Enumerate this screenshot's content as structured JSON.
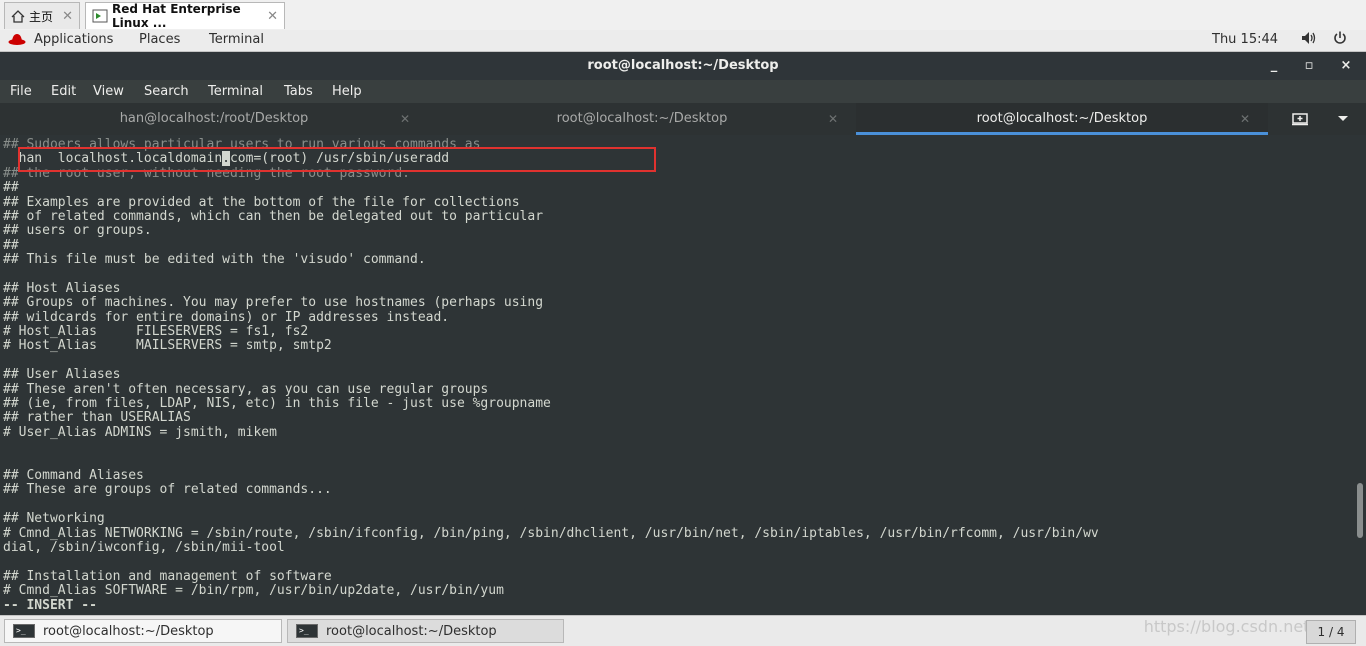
{
  "host_tabs": [
    {
      "label": "主页",
      "icon": "home-icon"
    },
    {
      "label": "Red Hat Enterprise Linux ...",
      "icon": "vm-icon"
    }
  ],
  "gnome": {
    "applications": "Applications",
    "places": "Places",
    "terminal": "Terminal",
    "clock": "Thu 15:44"
  },
  "window": {
    "title": "root@localhost:~/Desktop",
    "minimize": "_",
    "maximize": "▫",
    "close": "×"
  },
  "menu": [
    "File",
    "Edit",
    "View",
    "Search",
    "Terminal",
    "Tabs",
    "Help"
  ],
  "terminal_tabs": [
    {
      "label": "han@localhost:/root/Desktop"
    },
    {
      "label": "root@localhost:~/Desktop"
    },
    {
      "label": "root@localhost:~/Desktop"
    }
  ],
  "terminal": {
    "lines": [
      "## Sudoers allows particular users to run various commands as",
      "  han  localhost.localdomain.com=(root) /usr/sbin/useradd",
      "## the root user, without needing the root password.",
      "##",
      "## Examples are provided at the bottom of the file for collections",
      "## of related commands, which can then be delegated out to particular",
      "## users or groups.",
      "##",
      "## This file must be edited with the 'visudo' command.",
      "",
      "## Host Aliases",
      "## Groups of machines. You may prefer to use hostnames (perhaps using",
      "## wildcards for entire domains) or IP addresses instead.",
      "# Host_Alias     FILESERVERS = fs1, fs2",
      "# Host_Alias     MAILSERVERS = smtp, smtp2",
      "",
      "## User Aliases",
      "## These aren't often necessary, as you can use regular groups",
      "## (ie, from files, LDAP, NIS, etc) in this file - just use %groupname",
      "## rather than USERALIAS",
      "# User_Alias ADMINS = jsmith, mikem",
      "",
      "",
      "## Command Aliases",
      "## These are groups of related commands...",
      "",
      "## Networking",
      "# Cmnd_Alias NETWORKING = /sbin/route, /sbin/ifconfig, /bin/ping, /sbin/dhclient, /usr/bin/net, /sbin/iptables, /usr/bin/rfcomm, /usr/bin/wv",
      "dial, /sbin/iwconfig, /sbin/mii-tool",
      "",
      "## Installation and management of software",
      "# Cmnd_Alias SOFTWARE = /bin/rpm, /usr/bin/up2date, /usr/bin/yum"
    ],
    "edited_before_cursor": "  han  localhost.localdomain",
    "cursor_char": ".",
    "edited_after_cursor": "com=(root) /usr/sbin/useradd",
    "mode": "-- INSERT --"
  },
  "taskbar": {
    "items": [
      {
        "label": "root@localhost:~/Desktop"
      },
      {
        "label": "root@localhost:~/Desktop"
      }
    ],
    "pager": "1 / 4",
    "watermark": "https://blog.csdn.net/wfl"
  }
}
